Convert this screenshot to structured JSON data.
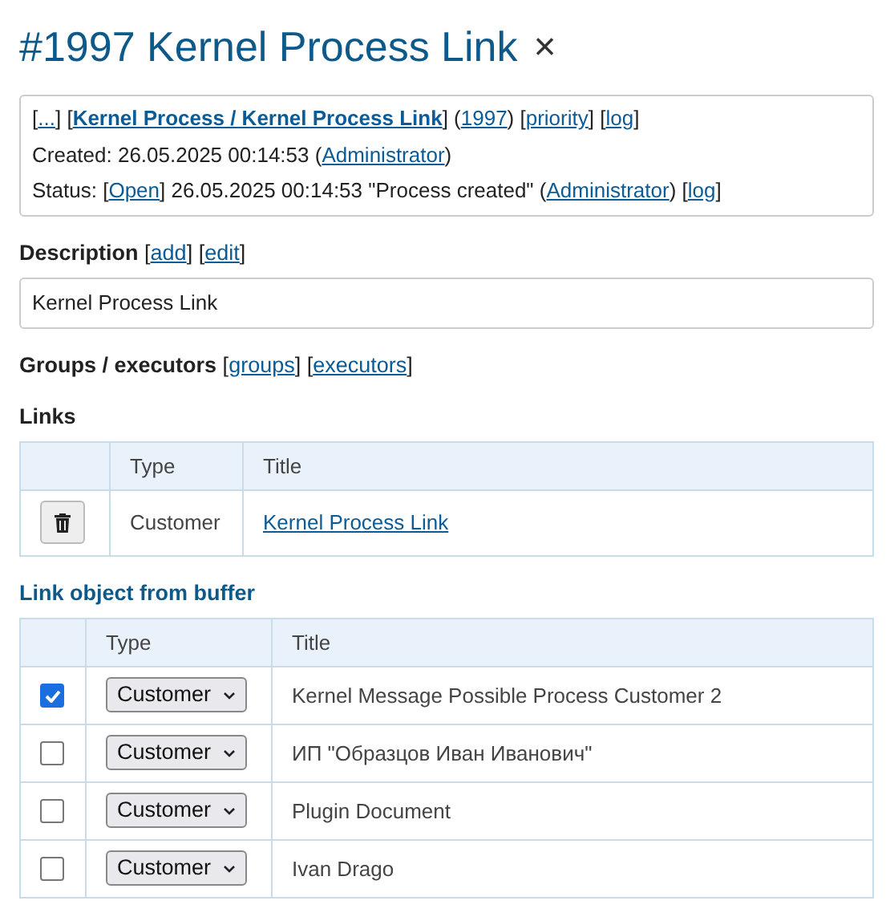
{
  "header": {
    "title": "#1997 Kernel Process Link",
    "close": "×"
  },
  "info": {
    "lines": [
      [
        {
          "kind": "plain",
          "text": "["
        },
        {
          "kind": "link",
          "text": "..."
        },
        {
          "kind": "plain",
          "text": "] ["
        },
        {
          "kind": "link",
          "text": "Kernel Process / Kernel Process Link",
          "bold": true
        },
        {
          "kind": "plain",
          "text": "] ("
        },
        {
          "kind": "link",
          "text": "1997"
        },
        {
          "kind": "plain",
          "text": ") ["
        },
        {
          "kind": "link",
          "text": "priority"
        },
        {
          "kind": "plain",
          "text": "] ["
        },
        {
          "kind": "link",
          "text": "log"
        },
        {
          "kind": "plain",
          "text": "]"
        }
      ],
      [
        {
          "kind": "plain",
          "text": "Created: 26.05.2025 00:14:53 ("
        },
        {
          "kind": "link",
          "text": "Administrator"
        },
        {
          "kind": "plain",
          "text": ")"
        }
      ],
      [
        {
          "kind": "plain",
          "text": "Status: ["
        },
        {
          "kind": "link",
          "text": "Open"
        },
        {
          "kind": "plain",
          "text": "] 26.05.2025 00:14:53 \"Process created\" ("
        },
        {
          "kind": "link",
          "text": "Administrator"
        },
        {
          "kind": "plain",
          "text": ") ["
        },
        {
          "kind": "link",
          "text": "log"
        },
        {
          "kind": "plain",
          "text": "]"
        }
      ]
    ]
  },
  "description": {
    "heading": [
      {
        "kind": "label",
        "text": "Description"
      },
      {
        "kind": "plain",
        "text": " ["
      },
      {
        "kind": "link",
        "text": "add"
      },
      {
        "kind": "plain",
        "text": "] ["
      },
      {
        "kind": "link",
        "text": "edit"
      },
      {
        "kind": "plain",
        "text": "]"
      }
    ],
    "value": "Kernel Process Link"
  },
  "groups": {
    "heading": [
      {
        "kind": "label",
        "text": "Groups / executors"
      },
      {
        "kind": "plain",
        "text": " ["
      },
      {
        "kind": "link",
        "text": "groups"
      },
      {
        "kind": "plain",
        "text": "] ["
      },
      {
        "kind": "link",
        "text": "executors"
      },
      {
        "kind": "plain",
        "text": "]"
      }
    ]
  },
  "links": {
    "heading": "Links",
    "columns": [
      "Type",
      "Title"
    ],
    "rows": [
      {
        "type": "Customer",
        "title": "Kernel Process Link"
      }
    ]
  },
  "buffer": {
    "heading": "Link object from buffer",
    "columns": [
      "Type",
      "Title"
    ],
    "rows": [
      {
        "checked": true,
        "type": "Customer",
        "title": "Kernel Message Possible Process Customer 2"
      },
      {
        "checked": false,
        "type": "Customer",
        "title": "ИП \"Образцов Иван Иванович\""
      },
      {
        "checked": false,
        "type": "Customer",
        "title": "Plugin Document"
      },
      {
        "checked": false,
        "type": "Customer",
        "title": "Ivan Drago"
      }
    ]
  }
}
